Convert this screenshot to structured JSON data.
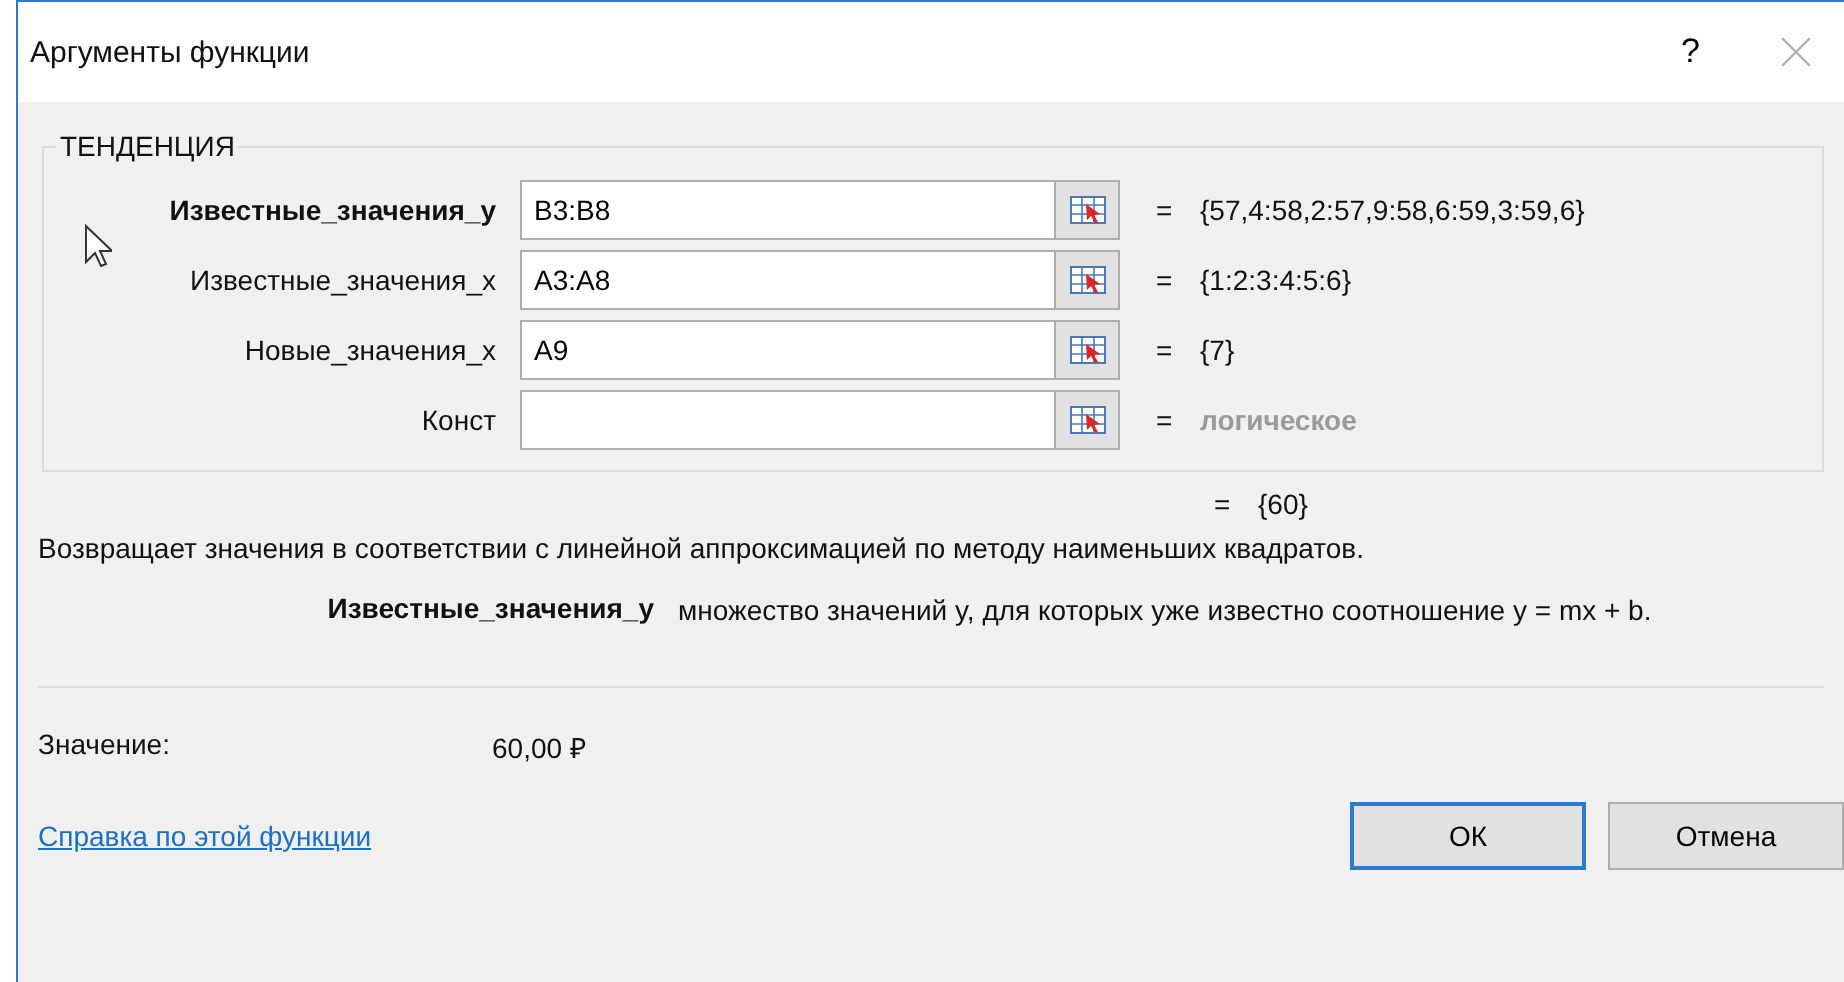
{
  "window": {
    "title": "Аргументы функции",
    "help_button": "?"
  },
  "function_name": "ТЕНДЕНЦИЯ",
  "arguments": [
    {
      "name": "Известные_значения_y",
      "active": true,
      "value": "B3:B8",
      "result": "{57,4:58,2:57,9:58,6:59,3:59,6}",
      "greyed": false
    },
    {
      "name": "Известные_значения_x",
      "active": false,
      "value": "A3:A8",
      "result": "{1:2:3:4:5:6}",
      "greyed": false
    },
    {
      "name": "Новые_значения_x",
      "active": false,
      "value": "A9",
      "result": "{7}",
      "greyed": false
    },
    {
      "name": "Конст",
      "active": false,
      "result": "логическое",
      "greyed": true
    }
  ],
  "equals": "=",
  "formula_result": "{60}",
  "description": "Возвращает значения в соответствии с линейной аппроксимацией по методу наименьших квадратов.",
  "argument_help": {
    "name": "Известные_значения_y",
    "text": "множество значений y, для которых уже известно соотношение y = mx + b."
  },
  "value_label": "Значение:",
  "value": "60,00 ₽",
  "help_link": "Справка по этой функции",
  "buttons": [
    {
      "label": "ОК",
      "default": true
    },
    {
      "label": "Отмена",
      "default": false
    }
  ]
}
